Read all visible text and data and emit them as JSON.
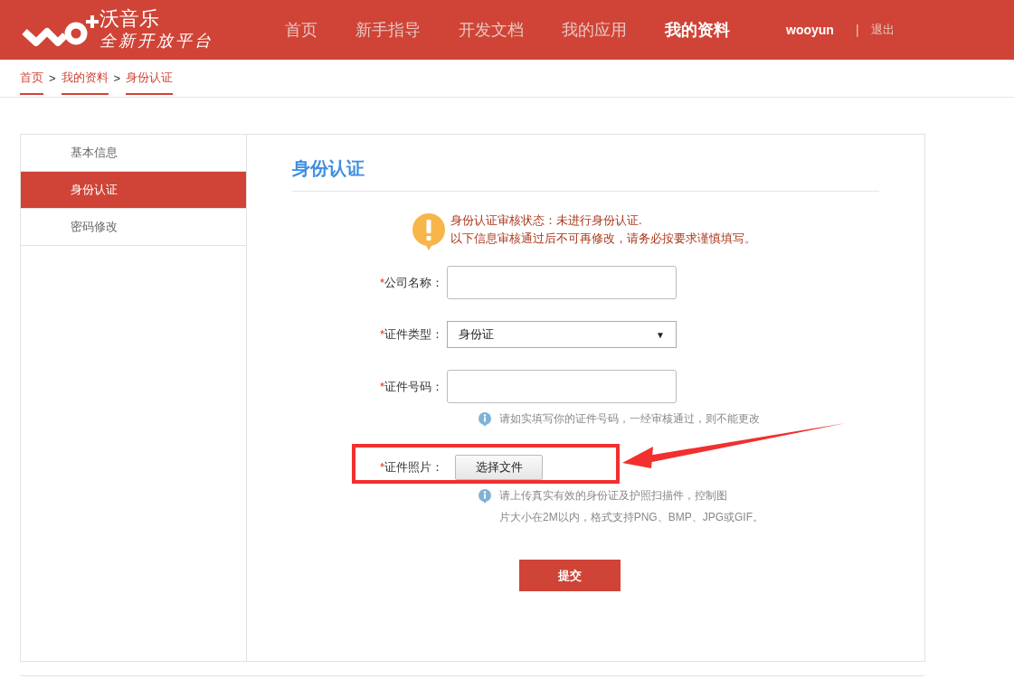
{
  "header": {
    "brand": "沃音乐",
    "slogan": "全新开放平台",
    "nav": [
      {
        "label": "首页",
        "selected": false
      },
      {
        "label": "新手指导",
        "selected": false
      },
      {
        "label": "开发文档",
        "selected": false
      },
      {
        "label": "我的应用",
        "selected": false
      },
      {
        "label": "我的资料",
        "selected": true
      }
    ],
    "user": "wooyun",
    "separator": "|",
    "logout": "退出"
  },
  "breadcrumb": {
    "items": [
      "首页",
      "我的资料",
      "身份认证"
    ],
    "separator": ">"
  },
  "sidebar": {
    "items": [
      {
        "label": "基本信息",
        "selected": false
      },
      {
        "label": "身份认证",
        "selected": true
      },
      {
        "label": "密码修改",
        "selected": false
      }
    ]
  },
  "content": {
    "title": "身份认证",
    "alert": [
      "身份认证审核状态：未进行身份认证.",
      "以下信息审核通过后不可再修改，请务必按要求谨慎填写。"
    ],
    "fields": [
      {
        "kind": "text",
        "required": "*",
        "label": "公司名称："
      },
      {
        "kind": "select",
        "required": "*",
        "label": "证件类型：",
        "value": "身份证",
        "caret": "▼"
      },
      {
        "kind": "text",
        "required": "*",
        "label": "证件号码：",
        "hint": [
          "请如实填写你的证件号码，一经审核通过，则不能更改"
        ]
      },
      {
        "kind": "file",
        "required": "*",
        "label": "证件照片：",
        "button": "选择文件",
        "highlighted": true,
        "hint": [
          "请上传真实有效的身份证及护照扫描件，控制图",
          "片大小在2M以内，格式支持PNG、BMP、JPG或GIF。"
        ]
      }
    ],
    "submit": "提交"
  }
}
